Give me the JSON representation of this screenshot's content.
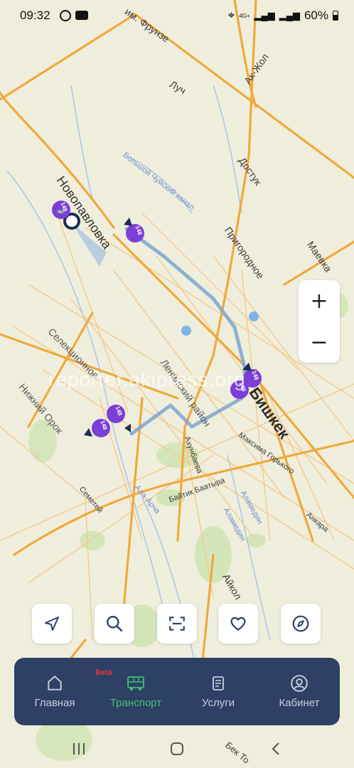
{
  "status": {
    "time": "09:32",
    "signal": "4G+",
    "battery": "60%"
  },
  "map": {
    "labels": {
      "frunze": "им. Фрунзе",
      "luch": "Луч",
      "ak_zhol": "Ак-Жол",
      "dostuk": "Достук",
      "big_chui_canal": "Большой Чуйский канал",
      "novopavlovka": "Новопавловка",
      "prigorodnoe": "Пригородное",
      "maevka": "Маевка",
      "selektsionnoe": "Селекционное",
      "nizhniy_orok": "Нижний Орок",
      "leninsky": "Ленинский район",
      "bishkek": "Бишкек",
      "maksima_gorkogo": "Максима Горького",
      "akhunbaeva": "Ахунбаева",
      "baitik_baatyra": "Байтик Баатыра",
      "ala_archa": "Ала-Арча",
      "alamedin": "Аламедин",
      "ankara": "Анкара",
      "semetey": "Семетей",
      "aikol": "Айкол",
      "bek_too": "Бек То",
      "bus_number": "148"
    },
    "watermark": "reporter.akipress.org"
  },
  "controls": {
    "zoom_in": "+",
    "zoom_out": "−"
  },
  "toolbar": {
    "items": [
      "location-arrow-icon",
      "search-icon",
      "scan-icon",
      "heart-icon",
      "compass-icon"
    ]
  },
  "nav": {
    "beta": "Beta",
    "items": [
      {
        "label": "Главная",
        "icon": "home-icon"
      },
      {
        "label": "Транспорт",
        "icon": "bus-icon"
      },
      {
        "label": "Услуги",
        "icon": "document-icon"
      },
      {
        "label": "Кабинет",
        "icon": "user-icon"
      }
    ]
  },
  "colors": {
    "accent": "#3ec46d",
    "nav_bg": "#2e4066",
    "bus_marker": "#7b3fd6",
    "route": "#7aa6cf",
    "major_road": "#f0a93a"
  }
}
